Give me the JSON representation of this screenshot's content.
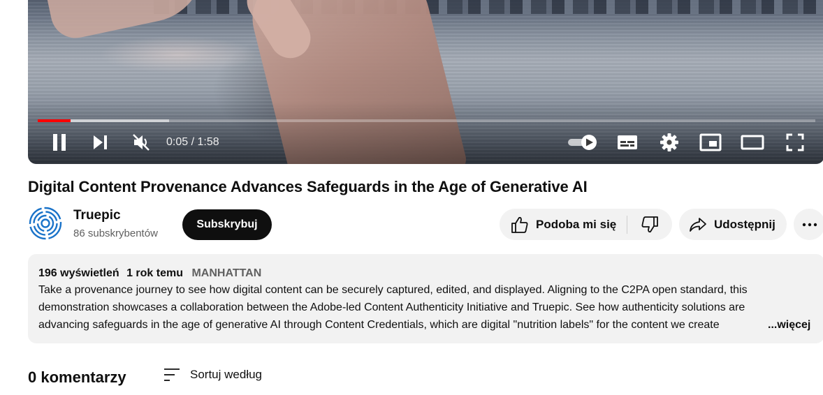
{
  "player": {
    "current_time": "0:05",
    "duration": "1:58",
    "time_separator": " / ",
    "played_fraction": 0.042,
    "buffered_fraction": 0.169,
    "state": "playing",
    "muted": true,
    "autoplay_on": true
  },
  "video": {
    "title": "Digital Content Provenance Advances Safeguards in the Age of Generative AI"
  },
  "channel": {
    "name": "Truepic",
    "subscribers": "86 subskrybentów",
    "subscribe_label": "Subskrybuj"
  },
  "actions": {
    "like_label": "Podoba mi się",
    "share_label": "Udostępnij"
  },
  "description": {
    "views": "196 wyświetleń",
    "date": "1 rok temu",
    "location": "MANHATTAN",
    "lines": [
      "Take a provenance journey to see how digital content can be securely captured, edited, and displayed. Aligning to the C2PA open standard, this",
      "demonstration showcases a collaboration between the Adobe-led Content Authenticity Initiative and Truepic. See how authenticity solutions are",
      "advancing safeguards in the age of generative AI through Content Credentials, which are digital \"nutrition labels\" for the content we create"
    ],
    "more_label": "...więcej"
  },
  "comments": {
    "count_label": "0 komentarzy",
    "sort_label": "Sortuj według"
  },
  "colors": {
    "accent": "#ff0000",
    "subscribe_bg": "#0f0f0f",
    "chip_bg": "#f2f2f2",
    "secondary_text": "#606060",
    "avatar_brand": "#1a73c9"
  },
  "icons": {
    "play_pause": "pause-icon",
    "next": "next-icon",
    "volume": "volume-muted-icon",
    "autoplay": "autoplay-toggle-icon",
    "subtitles": "subtitles-icon",
    "settings": "gear-icon",
    "miniplayer": "miniplayer-icon",
    "theater": "theater-mode-icon",
    "fullscreen": "fullscreen-icon",
    "like": "thumbs-up-icon",
    "dislike": "thumbs-down-icon",
    "share": "share-arrow-icon",
    "more": "more-horizontal-icon",
    "sort": "sort-lines-icon"
  }
}
